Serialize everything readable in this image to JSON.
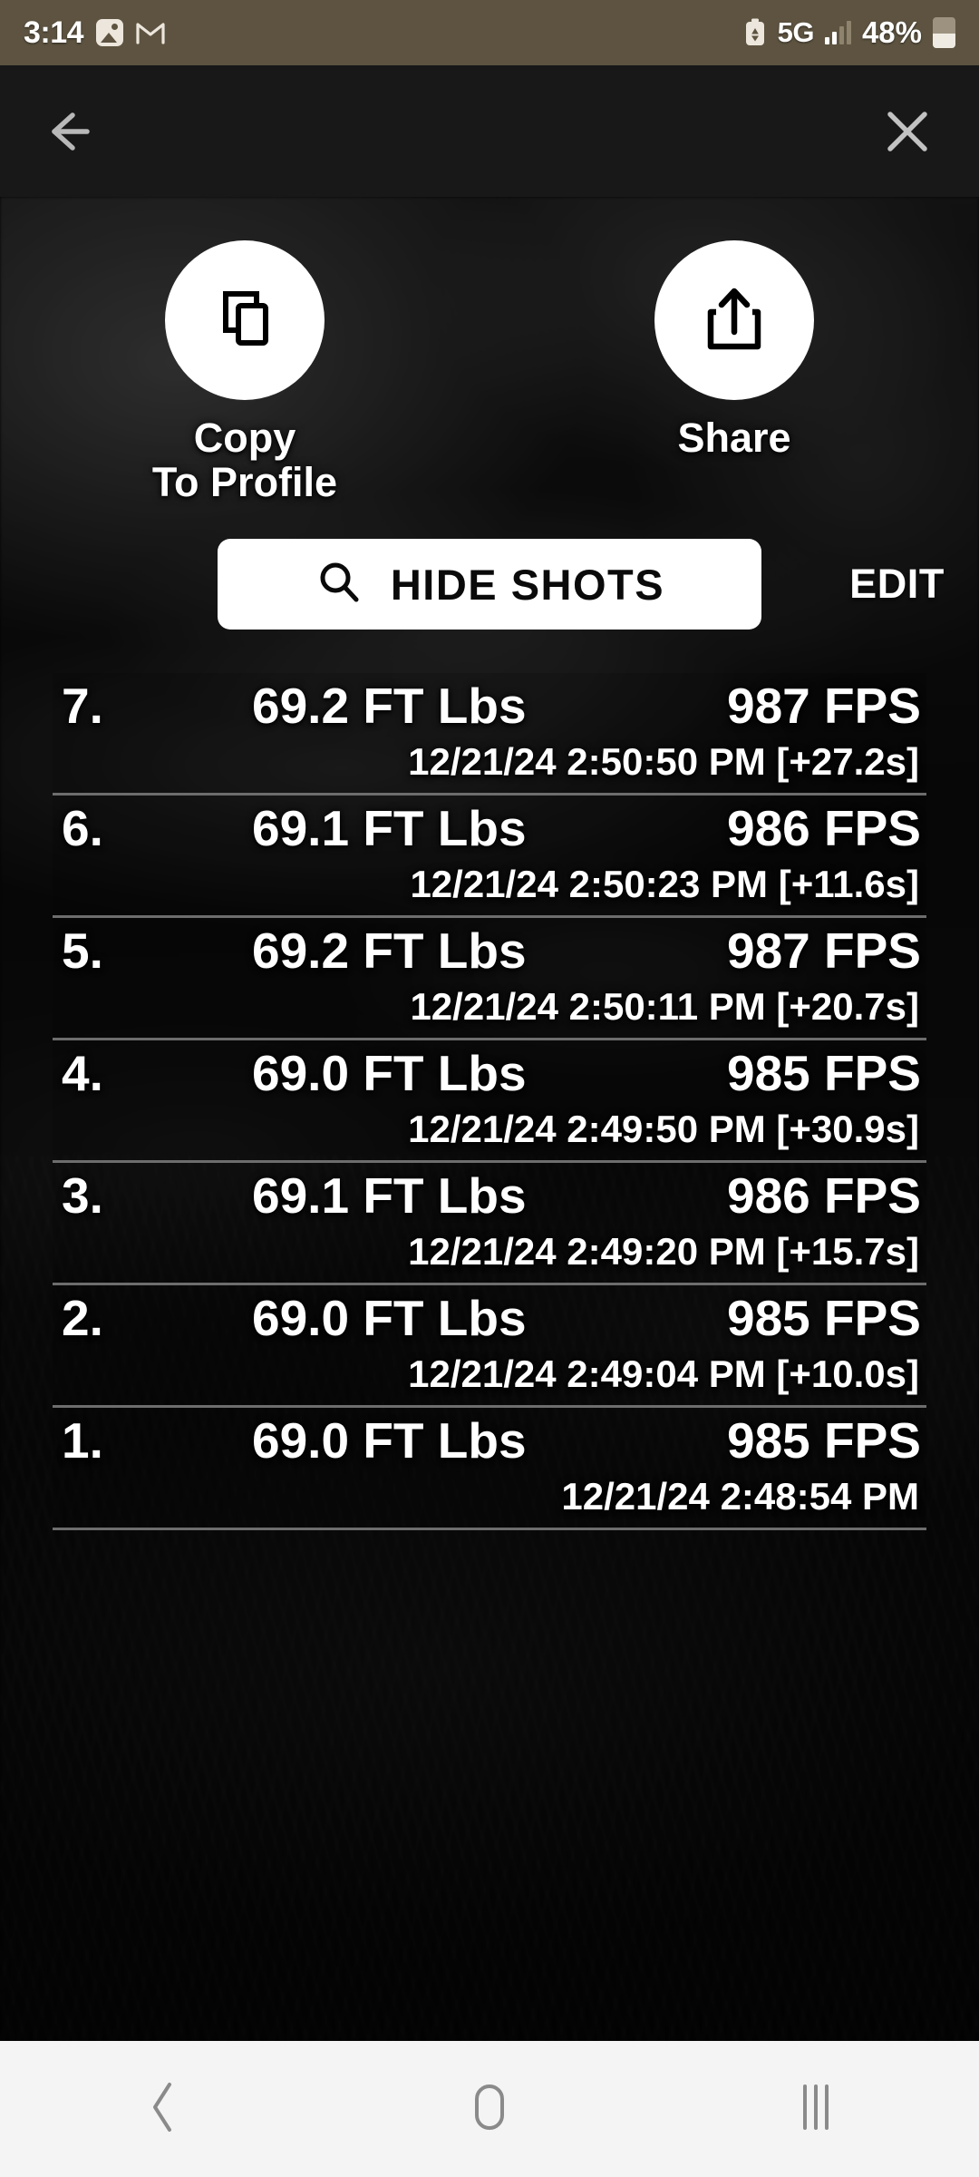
{
  "status_bar": {
    "time": "3:14",
    "network": "5G",
    "battery_percent": "48%",
    "icons": [
      "photo-icon",
      "gmail-icon",
      "battery-saver-icon",
      "signal-icon",
      "battery-icon"
    ]
  },
  "top_nav": {
    "back_label": "back-arrow",
    "close_label": "close-x"
  },
  "actions": [
    {
      "label": "Copy\nTo Profile",
      "icon": "copy-icon",
      "name": "copy-to-profile-button"
    },
    {
      "label": "Share",
      "icon": "share-icon",
      "name": "share-button"
    }
  ],
  "toolbar": {
    "hide_shots_label": "HIDE SHOTS",
    "search_icon": "search-icon",
    "edit_label": "EDIT"
  },
  "shots": [
    {
      "index": "7.",
      "energy": "69.2 FT Lbs",
      "speed": "987 FPS",
      "time": "12/21/24 2:50:50 PM [+27.2s]"
    },
    {
      "index": "6.",
      "energy": "69.1 FT Lbs",
      "speed": "986 FPS",
      "time": "12/21/24 2:50:23 PM [+11.6s]"
    },
    {
      "index": "5.",
      "energy": "69.2 FT Lbs",
      "speed": "987 FPS",
      "time": "12/21/24 2:50:11 PM [+20.7s]"
    },
    {
      "index": "4.",
      "energy": "69.0 FT Lbs",
      "speed": "985 FPS",
      "time": "12/21/24 2:49:50 PM [+30.9s]"
    },
    {
      "index": "3.",
      "energy": "69.1 FT Lbs",
      "speed": "986 FPS",
      "time": "12/21/24 2:49:20 PM [+15.7s]"
    },
    {
      "index": "2.",
      "energy": "69.0 FT Lbs",
      "speed": "985 FPS",
      "time": "12/21/24 2:49:04 PM [+10.0s]"
    },
    {
      "index": "1.",
      "energy": "69.0 FT Lbs",
      "speed": "985 FPS",
      "time": "12/21/24 2:48:54 PM"
    }
  ],
  "nav_bar": {
    "back": "back-chevron-icon",
    "home": "home-icon",
    "recents": "recents-icon"
  },
  "colors": {
    "status_bar_bg": "#5d5340",
    "top_bar_bg": "#181818",
    "nav_bar_bg": "#f4f4f4",
    "accent_white": "#ffffff",
    "divider": "#6d6d6d"
  }
}
